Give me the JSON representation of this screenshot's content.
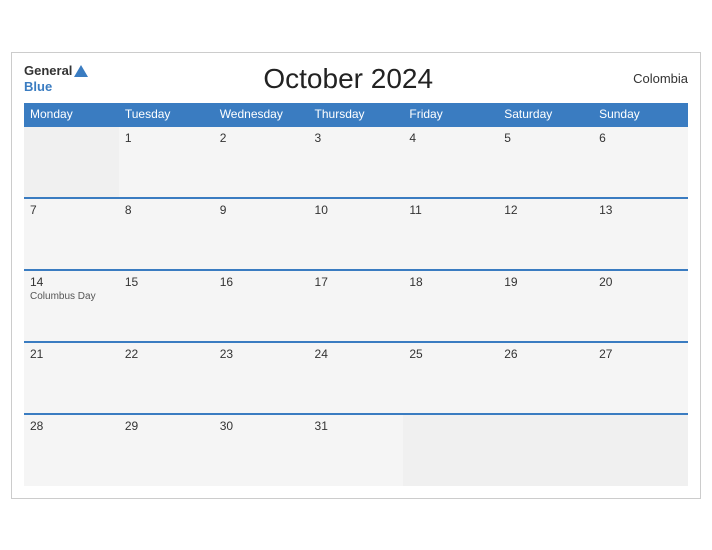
{
  "header": {
    "title": "October 2024",
    "country": "Colombia",
    "logo_general": "General",
    "logo_blue": "Blue"
  },
  "weekdays": [
    "Monday",
    "Tuesday",
    "Wednesday",
    "Thursday",
    "Friday",
    "Saturday",
    "Sunday"
  ],
  "weeks": [
    [
      {
        "day": "",
        "empty": true
      },
      {
        "day": "1",
        "empty": false
      },
      {
        "day": "2",
        "empty": false
      },
      {
        "day": "3",
        "empty": false
      },
      {
        "day": "4",
        "empty": false
      },
      {
        "day": "5",
        "empty": false
      },
      {
        "day": "6",
        "empty": false
      }
    ],
    [
      {
        "day": "7",
        "empty": false
      },
      {
        "day": "8",
        "empty": false
      },
      {
        "day": "9",
        "empty": false
      },
      {
        "day": "10",
        "empty": false
      },
      {
        "day": "11",
        "empty": false
      },
      {
        "day": "12",
        "empty": false
      },
      {
        "day": "13",
        "empty": false
      }
    ],
    [
      {
        "day": "14",
        "holiday": "Columbus Day",
        "empty": false
      },
      {
        "day": "15",
        "empty": false
      },
      {
        "day": "16",
        "empty": false
      },
      {
        "day": "17",
        "empty": false
      },
      {
        "day": "18",
        "empty": false
      },
      {
        "day": "19",
        "empty": false
      },
      {
        "day": "20",
        "empty": false
      }
    ],
    [
      {
        "day": "21",
        "empty": false
      },
      {
        "day": "22",
        "empty": false
      },
      {
        "day": "23",
        "empty": false
      },
      {
        "day": "24",
        "empty": false
      },
      {
        "day": "25",
        "empty": false
      },
      {
        "day": "26",
        "empty": false
      },
      {
        "day": "27",
        "empty": false
      }
    ],
    [
      {
        "day": "28",
        "empty": false
      },
      {
        "day": "29",
        "empty": false
      },
      {
        "day": "30",
        "empty": false
      },
      {
        "day": "31",
        "empty": false
      },
      {
        "day": "",
        "empty": true
      },
      {
        "day": "",
        "empty": true
      },
      {
        "day": "",
        "empty": true
      }
    ]
  ]
}
